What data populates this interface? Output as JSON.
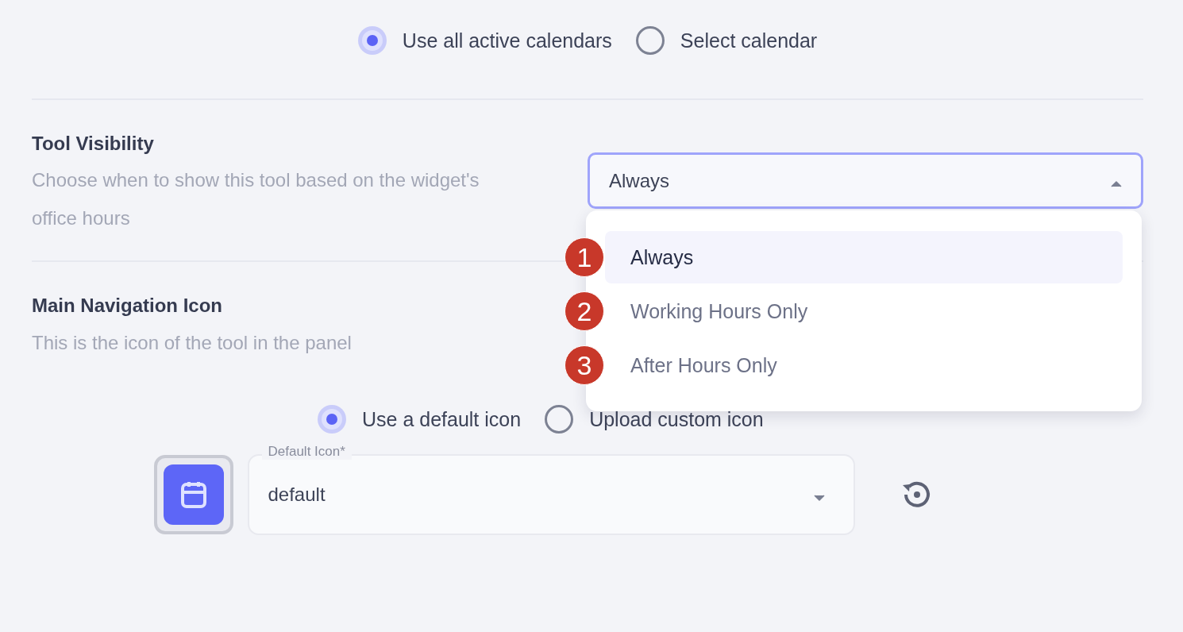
{
  "calendar_source": {
    "options": [
      {
        "label": "Use all active calendars",
        "selected": true
      },
      {
        "label": "Select calendar",
        "selected": false
      }
    ]
  },
  "tool_visibility": {
    "title": "Tool Visibility",
    "description": "Choose when to show this tool based on the widget's office hours",
    "select": {
      "value": "Always",
      "expanded": true
    },
    "menu": [
      {
        "badge": "1",
        "label": "Always",
        "selected": true
      },
      {
        "badge": "2",
        "label": "Working Hours Only",
        "selected": false
      },
      {
        "badge": "3",
        "label": "After Hours Only",
        "selected": false
      }
    ]
  },
  "main_navigation_icon": {
    "title": "Main Navigation Icon",
    "description": "This is the icon of the tool in the panel",
    "options": [
      {
        "label": "Use a default icon",
        "selected": true
      },
      {
        "label": "Upload custom icon",
        "selected": false
      }
    ],
    "icon_select": {
      "label": "Default Icon*",
      "value": "default",
      "expanded": false
    }
  }
}
